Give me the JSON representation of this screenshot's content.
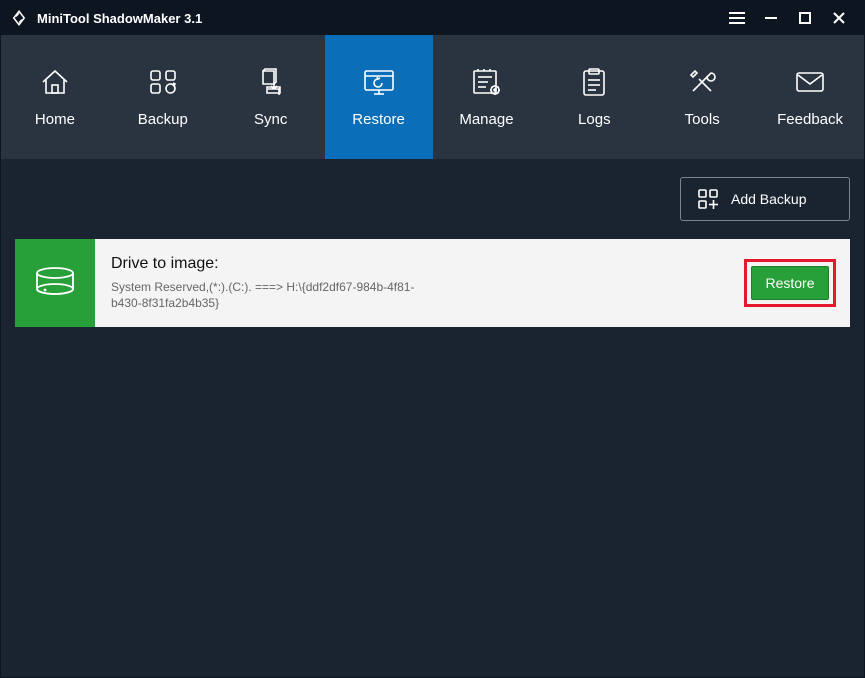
{
  "titlebar": {
    "title": "MiniTool ShadowMaker 3.1"
  },
  "nav": {
    "items": [
      {
        "label": "Home",
        "active": false
      },
      {
        "label": "Backup",
        "active": false
      },
      {
        "label": "Sync",
        "active": false
      },
      {
        "label": "Restore",
        "active": true
      },
      {
        "label": "Manage",
        "active": false
      },
      {
        "label": "Logs",
        "active": false
      },
      {
        "label": "Tools",
        "active": false
      },
      {
        "label": "Feedback",
        "active": false
      }
    ]
  },
  "toolbar": {
    "add_backup_label": "Add Backup"
  },
  "task": {
    "title": "Drive to image:",
    "detail": "System Reserved,(*:).(C:). ===> H:\\{ddf2df67-984b-4f81-b430-8f31fa2b4b35}",
    "restore_label": "Restore"
  }
}
